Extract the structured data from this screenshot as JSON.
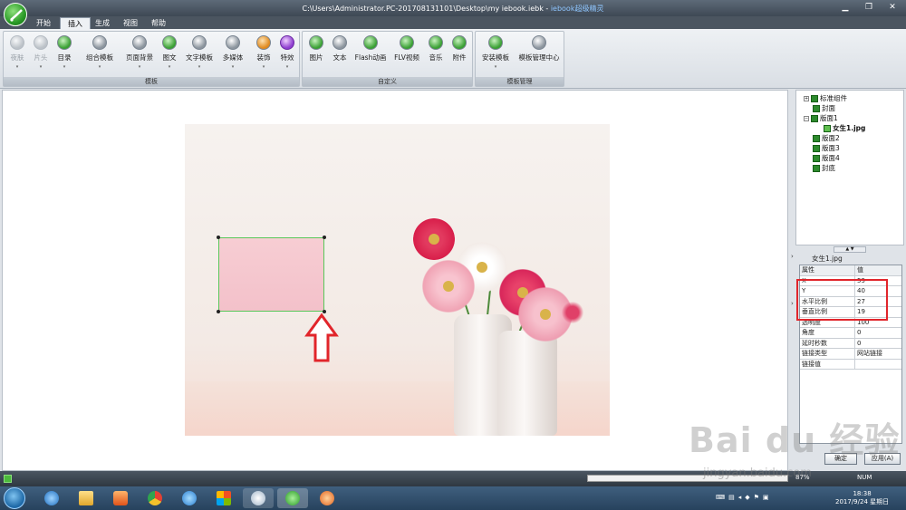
{
  "window": {
    "title_path": "C:\\Users\\Administrator.PC-201708131101\\Desktop\\my iebook.iebk",
    "title_sep": " - ",
    "title_app": "iebook超级精灵",
    "minimize": "▁",
    "restore": "❐",
    "close": "✕"
  },
  "menu": {
    "tabs": [
      {
        "label": "开始"
      },
      {
        "label": "插入"
      },
      {
        "label": "生成"
      },
      {
        "label": "视图"
      },
      {
        "label": "帮助"
      }
    ]
  },
  "ribbon": {
    "groups": [
      {
        "label": "模板"
      },
      {
        "label": "自定义"
      },
      {
        "label": "模板管理"
      }
    ],
    "buttons": [
      {
        "label": "夜肤",
        "icon": "skin-icon"
      },
      {
        "label": "片头",
        "icon": "intro-icon"
      },
      {
        "label": "目录",
        "icon": "toc-icon"
      },
      {
        "label": "组合模板",
        "icon": "combo-template-icon"
      },
      {
        "label": "页面背景",
        "icon": "page-background-icon"
      },
      {
        "label": "图文",
        "icon": "image-text-icon"
      },
      {
        "label": "文字模板",
        "icon": "text-template-icon"
      },
      {
        "label": "多媒体",
        "icon": "multimedia-icon"
      },
      {
        "label": "装饰",
        "icon": "decoration-icon"
      },
      {
        "label": "特效",
        "icon": "effects-icon"
      },
      {
        "label": "图片",
        "icon": "picture-icon"
      },
      {
        "label": "文本",
        "icon": "text-icon"
      },
      {
        "label": "Flash动画",
        "icon": "flash-icon"
      },
      {
        "label": "FLV视频",
        "icon": "flv-video-icon"
      },
      {
        "label": "音乐",
        "icon": "music-icon"
      },
      {
        "label": "附件",
        "icon": "attachment-icon"
      },
      {
        "label": "安装模板",
        "icon": "install-template-icon"
      },
      {
        "label": "模板管理中心",
        "icon": "template-center-icon"
      }
    ],
    "dropdown_glyph": "▾"
  },
  "tree": {
    "items": [
      {
        "label": "标准组件"
      },
      {
        "label": "封面"
      },
      {
        "label": "版面1"
      },
      {
        "label": "女生1.jpg"
      },
      {
        "label": "版面2"
      },
      {
        "label": "版面3"
      },
      {
        "label": "版面4"
      },
      {
        "label": "封底"
      }
    ],
    "expand_plus": "+",
    "expand_minus": "−",
    "splitter_glyph": "▲ ▼"
  },
  "properties": {
    "title": "女生1.jpg",
    "header": {
      "name": "属性",
      "value": "值"
    },
    "rows": [
      {
        "name": "X",
        "value": "59"
      },
      {
        "name": "Y",
        "value": "40"
      },
      {
        "name": "水平比例",
        "value": "27"
      },
      {
        "name": "垂直比例",
        "value": "19"
      },
      {
        "name": "透明度",
        "value": "100"
      },
      {
        "name": "角度",
        "value": "0"
      },
      {
        "name": "延时秒数",
        "value": "0"
      },
      {
        "name": "链接类型",
        "value": "网站链接"
      },
      {
        "name": "链接值",
        "value": ""
      }
    ],
    "side_arrow": "›",
    "apply_label": "应用(A)",
    "other_label": "确定"
  },
  "status": {
    "zoom": "87%",
    "num": "NUM"
  },
  "taskbar": {
    "time": "18:38",
    "date": "2017/9/24 星期日"
  },
  "watermark": {
    "brand": "Bai du 经验",
    "url": "jingyan.baidu.com"
  },
  "colors": {
    "accent": "#58c85a",
    "highlight": "#e1252b"
  }
}
